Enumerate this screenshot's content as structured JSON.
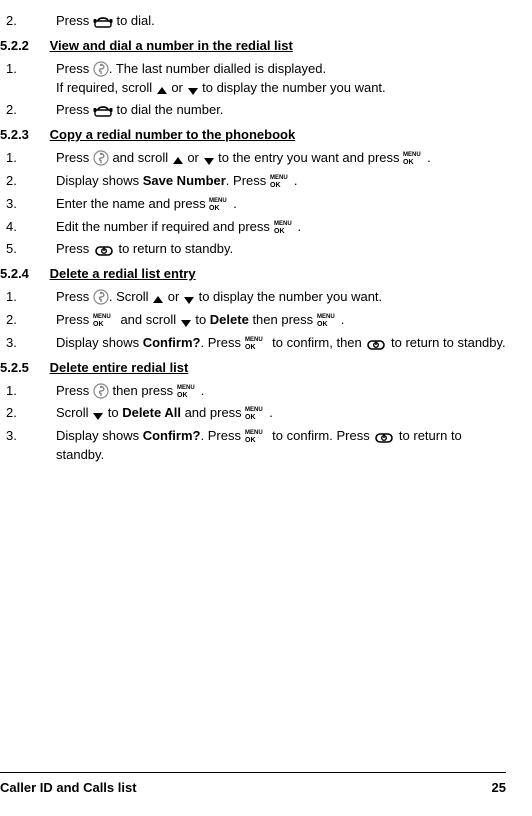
{
  "steps_521": [
    {
      "num": "2.",
      "parts": [
        {
          "t": "Press "
        },
        {
          "icon": "phone-icon"
        },
        {
          "t": " to dial."
        }
      ]
    }
  ],
  "sec_522": {
    "num": "5.2.2",
    "title": "View and dial a number in the redial list"
  },
  "steps_522": [
    {
      "num": "1.",
      "lines": [
        [
          {
            "t": "Press "
          },
          {
            "icon": "redial-icon"
          },
          {
            "t": ". The last number dialled is displayed."
          }
        ],
        [
          {
            "t": "If required, scroll "
          },
          {
            "icon": "up-icon"
          },
          {
            "t": " or "
          },
          {
            "icon": "down-icon"
          },
          {
            "t": " to display the number you want."
          }
        ]
      ]
    },
    {
      "num": "2.",
      "parts": [
        {
          "t": "Press "
        },
        {
          "icon": "phone-icon"
        },
        {
          "t": " to dial the number."
        }
      ]
    }
  ],
  "sec_523": {
    "num": "5.2.3",
    "title": "Copy a redial number to the phonebook"
  },
  "steps_523": [
    {
      "num": "1.",
      "parts": [
        {
          "t": "Press "
        },
        {
          "icon": "redial-icon"
        },
        {
          "t": " and scroll "
        },
        {
          "icon": "up-icon"
        },
        {
          "t": " or "
        },
        {
          "icon": "down-icon"
        },
        {
          "t": " to the entry you want and press "
        },
        {
          "icon": "menuok-icon"
        },
        {
          "t": "."
        }
      ]
    },
    {
      "num": "2.",
      "parts": [
        {
          "t": "Display shows "
        },
        {
          "bold": "Save Number"
        },
        {
          "t": ". Press "
        },
        {
          "icon": "menuok-icon"
        },
        {
          "t": "."
        }
      ]
    },
    {
      "num": "3.",
      "parts": [
        {
          "t": "Enter the name and press "
        },
        {
          "icon": "menuok-icon"
        },
        {
          "t": "."
        }
      ]
    },
    {
      "num": "4.",
      "parts": [
        {
          "t": "Edit the number if required and press "
        },
        {
          "icon": "menuok-icon"
        },
        {
          "t": "."
        }
      ]
    },
    {
      "num": "5.",
      "parts": [
        {
          "t": "Press "
        },
        {
          "icon": "end-icon"
        },
        {
          "t": " to return to standby."
        }
      ]
    }
  ],
  "sec_524": {
    "num": "5.2.4",
    "title": "Delete a redial list entry"
  },
  "steps_524": [
    {
      "num": "1.",
      "parts": [
        {
          "t": "Press "
        },
        {
          "icon": "redial-icon"
        },
        {
          "t": ". Scroll "
        },
        {
          "icon": "up-icon"
        },
        {
          "t": " or "
        },
        {
          "icon": "down-icon"
        },
        {
          "t": " to display the number you want."
        }
      ]
    },
    {
      "num": "2.",
      "parts": [
        {
          "t": "Press "
        },
        {
          "icon": "menuok-icon"
        },
        {
          "t": " and scroll "
        },
        {
          "icon": "down-icon"
        },
        {
          "t": " to "
        },
        {
          "bold": "Delete"
        },
        {
          "t": " then press "
        },
        {
          "icon": "menuok-icon"
        },
        {
          "t": "."
        }
      ]
    },
    {
      "num": "3.",
      "parts": [
        {
          "t": "Display shows "
        },
        {
          "bold": "Confirm?"
        },
        {
          "t": ". Press "
        },
        {
          "icon": "menuok-icon"
        },
        {
          "t": " to confirm, then "
        },
        {
          "icon": "end-icon"
        },
        {
          "t": " to return to standby."
        }
      ]
    }
  ],
  "sec_525": {
    "num": "5.2.5",
    "title": "Delete entire redial list"
  },
  "steps_525": [
    {
      "num": "1.",
      "parts": [
        {
          "t": "Press "
        },
        {
          "icon": "redial-icon"
        },
        {
          "t": " then press "
        },
        {
          "icon": "menuok-icon"
        },
        {
          "t": "."
        }
      ]
    },
    {
      "num": "2.",
      "parts": [
        {
          "t": "Scroll "
        },
        {
          "icon": "down-icon"
        },
        {
          "t": " to "
        },
        {
          "bold": "Delete All"
        },
        {
          "t": " and press "
        },
        {
          "icon": "menuok-icon"
        },
        {
          "t": "."
        }
      ]
    },
    {
      "num": "3.",
      "parts": [
        {
          "t": "Display shows "
        },
        {
          "bold": "Confirm?"
        },
        {
          "t": ". Press "
        },
        {
          "icon": "menuok-icon"
        },
        {
          "t": " to confirm. Press "
        },
        {
          "icon": "end-icon"
        },
        {
          "t": " to return to standby."
        }
      ]
    }
  ],
  "footer": {
    "title": "Caller ID and Calls list",
    "page": "25"
  }
}
